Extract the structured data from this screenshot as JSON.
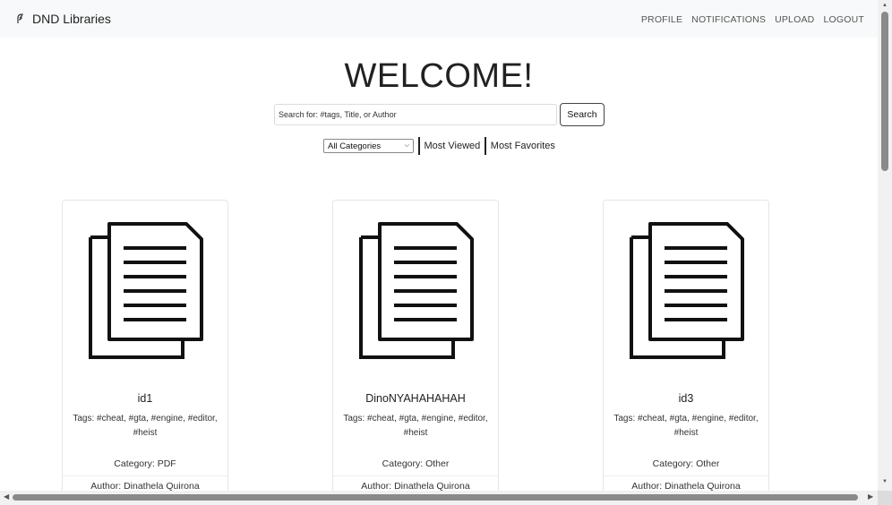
{
  "navbar": {
    "brand": "DND Libraries",
    "links": [
      "PROFILE",
      "NOTIFICATIONS",
      "UPLOAD",
      "LOGOUT"
    ]
  },
  "hero": {
    "title": "WELCOME!"
  },
  "search": {
    "placeholder": "Search for: #tags, Title, or Author",
    "button": "Search"
  },
  "filters": {
    "category_selected": "All Categories",
    "most_viewed": "Most Viewed",
    "most_favorites": "Most Favorites"
  },
  "cards": [
    {
      "title": "id1",
      "tags": "Tags: #cheat, #gta, #engine, #editor, #heist",
      "category": "Category: PDF",
      "author": "Author: Dinathela Quirona"
    },
    {
      "title": "DinoNYAHAHAHAH",
      "tags": "Tags: #cheat, #gta, #engine, #editor, #heist",
      "category": "Category: Other",
      "author": "Author: Dinathela Quirona"
    },
    {
      "title": "id3",
      "tags": "Tags: #cheat, #gta, #engine, #editor, #heist",
      "category": "Category: Other",
      "author": "Author: Dinathela Quirona"
    }
  ],
  "icons": {
    "brand": "feather-icon",
    "card": "document-icon",
    "select": "chevron-down-icon"
  }
}
